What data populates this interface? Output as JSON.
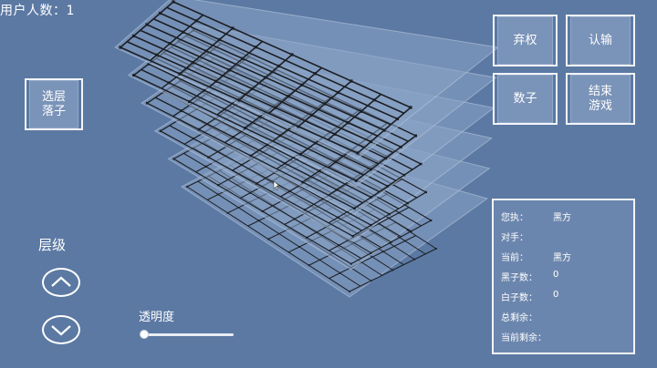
{
  "header": {
    "user_count_label": "用户人数：",
    "user_count": "1"
  },
  "buttons": {
    "select_layer": [
      "选层",
      "落子"
    ],
    "surrender": "弃权",
    "resign": "认输",
    "count": "数子",
    "end_game": [
      "结束",
      "游戏"
    ]
  },
  "layer": {
    "label": "层级"
  },
  "transparency": {
    "label": "透明度",
    "value": 0
  },
  "info": {
    "you_play_label": "您执：",
    "you_play": "黑方",
    "opponent_label": "对手：",
    "opponent": "",
    "current_label": "当前：",
    "current": "黑方",
    "black_count_label": "黑子数：",
    "black_count": "0",
    "white_count_label": "白子数：",
    "white_count": "0",
    "total_remaining_label": "总剩余：",
    "total_remaining": "",
    "current_remaining_label": "当前剩余：",
    "current_remaining": ""
  },
  "board": {
    "layers": 6,
    "grid_size": 9
  },
  "colors": {
    "background": "#5b79a3",
    "plate": "#8aa4c6",
    "line": "#1c1f24",
    "border": "#f2f4f8"
  }
}
